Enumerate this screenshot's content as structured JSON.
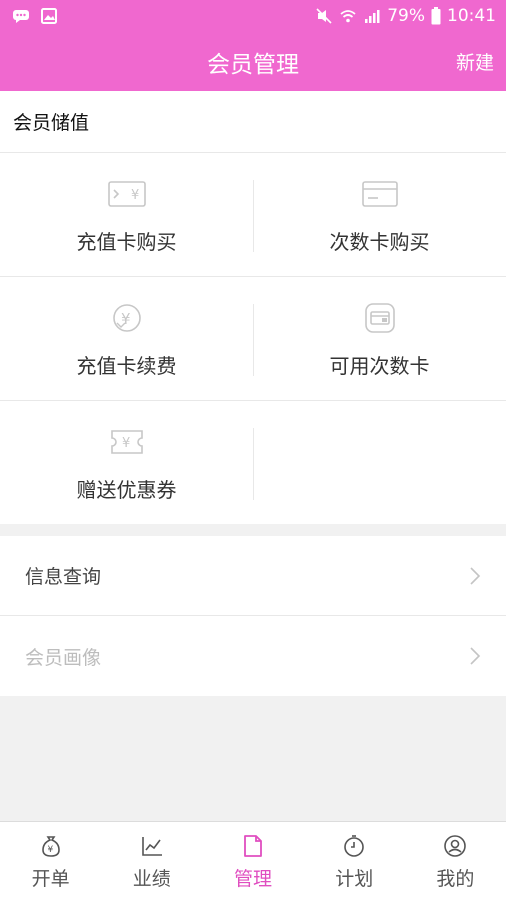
{
  "status_bar": {
    "battery": "79%",
    "time": "10:41",
    "icons": [
      "chat-icon",
      "image-icon",
      "mute-icon",
      "wifi-icon",
      "signal-icon",
      "battery-icon"
    ]
  },
  "nav": {
    "title": "会员管理",
    "action": "新建"
  },
  "colors": {
    "brand": "#f068cf",
    "active_tab": "#e04ec0"
  },
  "section": {
    "title": "会员储值"
  },
  "grid": {
    "items": [
      {
        "label": "充值卡购买",
        "icon": "recharge-card-icon"
      },
      {
        "label": "次数卡购买",
        "icon": "card-icon"
      },
      {
        "label": "充值卡续费",
        "icon": "renew-icon"
      },
      {
        "label": "可用次数卡",
        "icon": "wallet-card-icon"
      },
      {
        "label": "赠送优惠券",
        "icon": "coupon-icon"
      }
    ]
  },
  "list": {
    "items": [
      {
        "label": "信息查询",
        "icon": "chevron-right-icon"
      },
      {
        "label": "会员画像",
        "icon": "chevron-right-icon"
      }
    ]
  },
  "tabs": [
    {
      "label": "开单",
      "icon": "money-bag-icon"
    },
    {
      "label": "业绩",
      "icon": "chart-line-icon"
    },
    {
      "label": "管理",
      "icon": "document-icon"
    },
    {
      "label": "计划",
      "icon": "clock-icon"
    },
    {
      "label": "我的",
      "icon": "user-icon"
    }
  ]
}
